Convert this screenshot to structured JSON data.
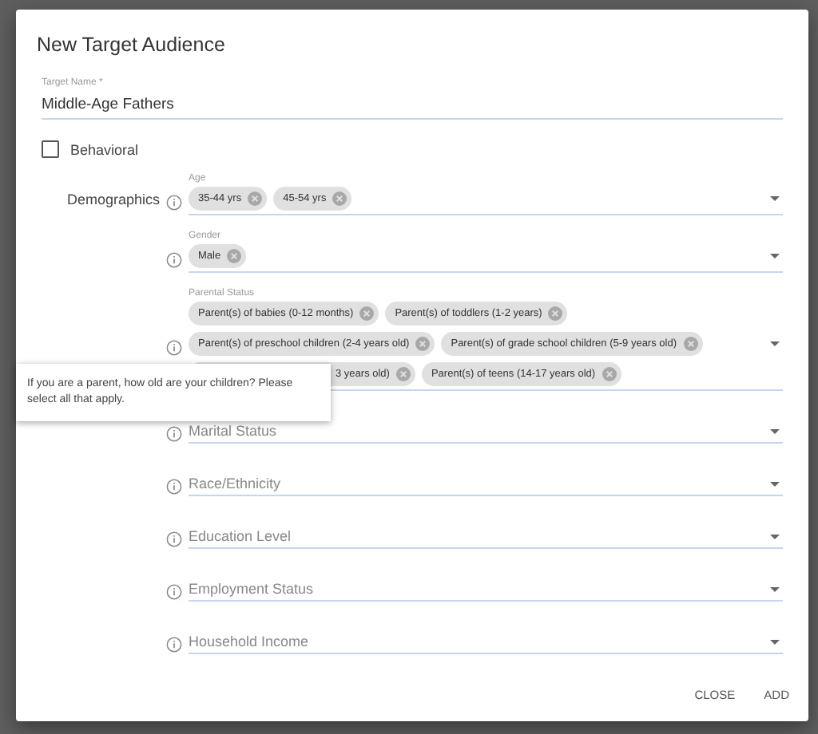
{
  "dialog": {
    "title": "New Target Audience",
    "target_name": {
      "label": "Target Name *",
      "value": "Middle-Age Fathers"
    },
    "behavioral": {
      "label": "Behavioral",
      "checked": false
    },
    "demographics": {
      "label": "Demographics",
      "fields": [
        {
          "label": "Age",
          "chips": [
            {
              "label": "35-44 yrs"
            },
            {
              "label": "45-54 yrs"
            }
          ]
        },
        {
          "label": "Gender",
          "chips": [
            {
              "label": "Male"
            }
          ]
        },
        {
          "label": "Parental Status",
          "chips": [
            {
              "label": "Parent(s) of babies (0-12 months)"
            },
            {
              "label": "Parent(s) of toddlers (1-2 years)"
            },
            {
              "label": "Parent(s) of preschool children (2-4 years old)"
            },
            {
              "label": "Parent(s) of grade school children (5-9 years old)"
            },
            {
              "label": "3 years old)",
              "partial": true
            },
            {
              "label": "Parent(s) of teens (14-17 years old)"
            }
          ],
          "tooltip": "If you are a parent, how old are your children? Please select all that apply."
        },
        {
          "placeholder": "Marital Status"
        },
        {
          "placeholder": "Race/Ethnicity"
        },
        {
          "placeholder": "Education Level"
        },
        {
          "placeholder": "Employment Status"
        },
        {
          "placeholder": "Household Income"
        }
      ]
    },
    "buttons": [
      "CLOSE",
      "ADD"
    ]
  }
}
